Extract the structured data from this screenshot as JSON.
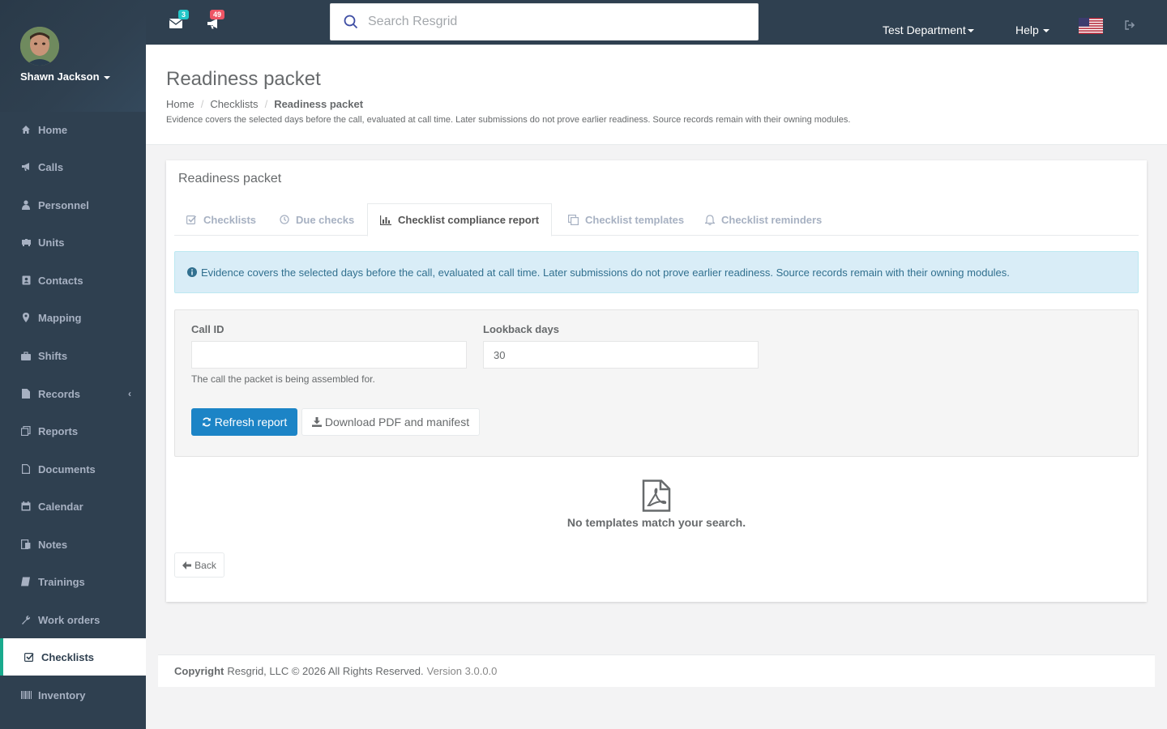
{
  "user": {
    "name": "Shawn Jackson"
  },
  "sidebar": {
    "items": [
      {
        "label": "Home",
        "icon": "home-icon"
      },
      {
        "label": "Calls",
        "icon": "bullhorn-icon"
      },
      {
        "label": "Personnel",
        "icon": "user-icon"
      },
      {
        "label": "Units",
        "icon": "truck-icon"
      },
      {
        "label": "Contacts",
        "icon": "address-book-icon"
      },
      {
        "label": "Mapping",
        "icon": "map-marker-icon"
      },
      {
        "label": "Shifts",
        "icon": "briefcase-icon"
      },
      {
        "label": "Records",
        "icon": "file-icon"
      },
      {
        "label": "Reports",
        "icon": "report-icon"
      },
      {
        "label": "Documents",
        "icon": "document-icon"
      },
      {
        "label": "Calendar",
        "icon": "calendar-icon"
      },
      {
        "label": "Notes",
        "icon": "notes-icon"
      },
      {
        "label": "Trainings",
        "icon": "book-icon"
      },
      {
        "label": "Work orders",
        "icon": "wrench-icon"
      },
      {
        "label": "Checklists",
        "icon": "check-square-icon",
        "active": true
      },
      {
        "label": "Inventory",
        "icon": "barcode-icon"
      }
    ]
  },
  "topbar": {
    "messages_count": "3",
    "alerts_count": "49",
    "search_placeholder": "Search Resgrid",
    "department": "Test Department",
    "help": "Help",
    "colors": {
      "messages_badge": "#23c6c8",
      "alerts_badge": "#ed5565"
    }
  },
  "heading": {
    "title": "Readiness packet",
    "breadcrumb": [
      "Home",
      "Checklists",
      "Readiness packet"
    ],
    "note": "Evidence covers the selected days before the call, evaluated at call time. Later submissions do not prove earlier readiness. Source records remain with their owning modules."
  },
  "panel": {
    "title": "Readiness packet",
    "tabs": [
      {
        "label": "Checklists",
        "icon": "check-square-icon"
      },
      {
        "label": "Due checks",
        "icon": "clock-icon"
      },
      {
        "label": "Checklist compliance report",
        "icon": "bar-chart-icon",
        "active": true
      },
      {
        "label": "Checklist templates",
        "icon": "copy-icon"
      },
      {
        "label": "Checklist reminders",
        "icon": "bell-icon"
      }
    ],
    "alert": "Evidence covers the selected days before the call, evaluated at call time. Later submissions do not prove earlier readiness. Source records remain with their owning modules.",
    "form": {
      "call_id_label": "Call ID",
      "call_id_value": "",
      "call_id_help": "The call the packet is being assembled for.",
      "lookback_label": "Lookback days",
      "lookback_value": "30",
      "refresh_label": "Refresh report",
      "download_label": "Download PDF and manifest"
    },
    "empty_text": "No templates match your search.",
    "back_label": "Back"
  },
  "footer": {
    "copyright_bold": "Copyright",
    "copyright": "Resgrid, LLC © 2026 All Rights Reserved.",
    "version": "Version 3.0.0.0"
  }
}
